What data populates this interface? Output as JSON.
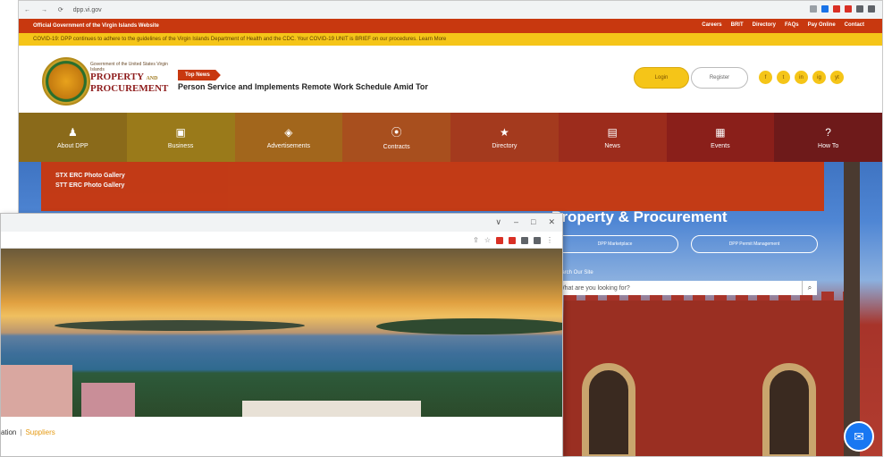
{
  "back_window": {
    "url": "dpp.vi.gov",
    "topbar_left": "Official Government of the Virgin Islands Website",
    "topbar_links": [
      "Careers",
      "BRIT",
      "Directory",
      "FAQs",
      "Pay Online",
      "Contact"
    ],
    "alert": "COVID-19: DPP continues to adhere to the guidelines of the Virgin Islands Department of Health and the CDC. Your COVID-19 UNIT is BRIEF on our procedures. Learn More",
    "logo_small": "Government of the United States Virgin Islands",
    "logo_line1": "PROPERTY",
    "logo_and": "AND",
    "logo_line2": "PROCUREMENT",
    "top_news_label": "Top News",
    "ticker": "Person Service and Implements Remote Work Schedule Amid Tor",
    "login_label": "Login",
    "register_label": "Register",
    "social_icons": [
      "f",
      "t",
      "in",
      "ig",
      "yt"
    ],
    "nav": [
      {
        "label": "About DPP",
        "icon": "people-icon",
        "glyph": "♟",
        "color": "#8a6a1a"
      },
      {
        "label": "Business",
        "icon": "briefcase-icon",
        "glyph": "▣",
        "color": "#9a7a1a"
      },
      {
        "label": "Advertisements",
        "icon": "megaphone-icon",
        "glyph": "◈",
        "color": "#a2661c"
      },
      {
        "label": "Contracts",
        "icon": "handshake-icon",
        "glyph": "⦿",
        "color": "#a84f1e"
      },
      {
        "label": "Directory",
        "icon": "star-icon",
        "glyph": "★",
        "color": "#a43a1e"
      },
      {
        "label": "News",
        "icon": "newspaper-icon",
        "glyph": "▤",
        "color": "#9c2c1c"
      },
      {
        "label": "Events",
        "icon": "calendar-icon",
        "glyph": "▦",
        "color": "#8a1f1a"
      },
      {
        "label": "How To",
        "icon": "question-icon",
        "glyph": "?",
        "color": "#6e1a1a"
      }
    ],
    "dropdown_items": [
      "STX ERC Photo Gallery",
      "STT ERC Photo Gallery"
    ],
    "hero_title": "Property & Procurement",
    "pill_buttons": [
      "DPP Marketplace",
      "DPP Permit Management"
    ],
    "search_label": "Search Our Site",
    "search_placeholder": "What are you looking for?"
  },
  "front_window": {
    "window_controls": [
      "∨",
      "–",
      "□",
      "✕"
    ],
    "breadcrumb": [
      "ation",
      "Suppliers"
    ]
  },
  "colors": {
    "accent_red": "#c8380f",
    "accent_yellow": "#f5c518",
    "messenger_blue": "#1877f2"
  }
}
